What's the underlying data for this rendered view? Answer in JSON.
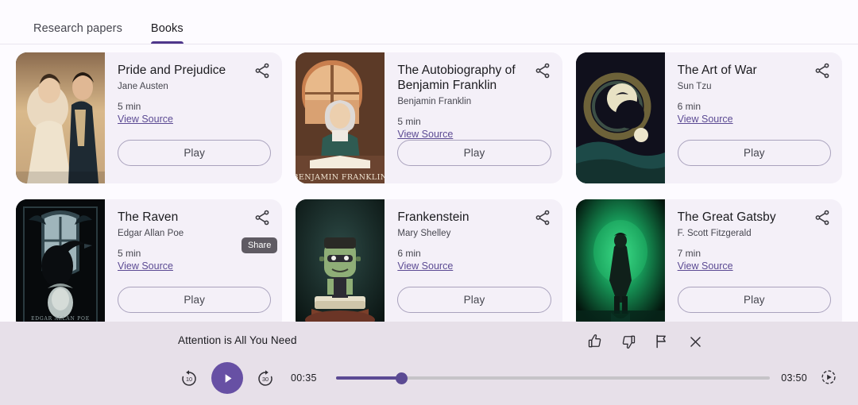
{
  "tabs": [
    {
      "label": "Research papers",
      "active": false
    },
    {
      "label": "Books",
      "active": true
    }
  ],
  "cards": [
    {
      "title": "Pride and Prejudice",
      "author": "Jane Austen",
      "duration": "5 min",
      "source_label": "View Source",
      "play_label": "Play",
      "share_icon": "share-icon",
      "tooltip": null,
      "cover": "regency-couple"
    },
    {
      "title": "The Autobiography of Benjamin Franklin",
      "author": "Benjamin Franklin",
      "duration": "5 min",
      "source_label": "View Source",
      "play_label": "Play",
      "share_icon": "share-icon",
      "tooltip": null,
      "cover": "franklin-desk",
      "cover_caption": "BENJAMIN FRANKLIN"
    },
    {
      "title": "The Art of War",
      "author": "Sun Tzu",
      "duration": "6 min",
      "source_label": "View Source",
      "play_label": "Play",
      "share_icon": "share-icon",
      "tooltip": null,
      "cover": "gold-circles-dark"
    },
    {
      "title": "The Raven",
      "author": "Edgar Allan Poe",
      "duration": "5 min",
      "source_label": "View Source",
      "play_label": "Play",
      "share_icon": "share-icon",
      "tooltip": "Share",
      "cover": "raven-arch",
      "cover_caption": "EDGAR ALLAN POE"
    },
    {
      "title": "Frankenstein",
      "author": "Mary Shelley",
      "duration": "6 min",
      "source_label": "View Source",
      "play_label": "Play",
      "share_icon": "share-icon",
      "tooltip": null,
      "cover": "frankenstein-book"
    },
    {
      "title": "The Great Gatsby",
      "author": "F. Scott Fitzgerald",
      "duration": "7 min",
      "source_label": "View Source",
      "play_label": "Play",
      "share_icon": "share-icon",
      "tooltip": null,
      "cover": "green-light-figure"
    }
  ],
  "player": {
    "title": "Attention is All You Need",
    "current_time": "00:35",
    "total_time": "03:50",
    "progress_percent": 15,
    "rewind_seconds": "10",
    "forward_seconds": "30",
    "state": "playing",
    "actions": [
      {
        "name": "thumb-up-icon",
        "label": "Thumbs up"
      },
      {
        "name": "thumb-down-icon",
        "label": "Thumbs down"
      },
      {
        "name": "flag-icon",
        "label": "Report"
      },
      {
        "name": "close-icon",
        "label": "Close"
      }
    ],
    "speed_icon": "playback-speed-icon"
  },
  "colors": {
    "accent": "#6750a4",
    "accent_dark": "#4f378b",
    "link": "#5b4a93",
    "card_bg": "#f4f0f8",
    "player_bg": "#e7e0e9",
    "page_bg": "#fdfbff",
    "tooltip_bg": "#5f5b63"
  }
}
